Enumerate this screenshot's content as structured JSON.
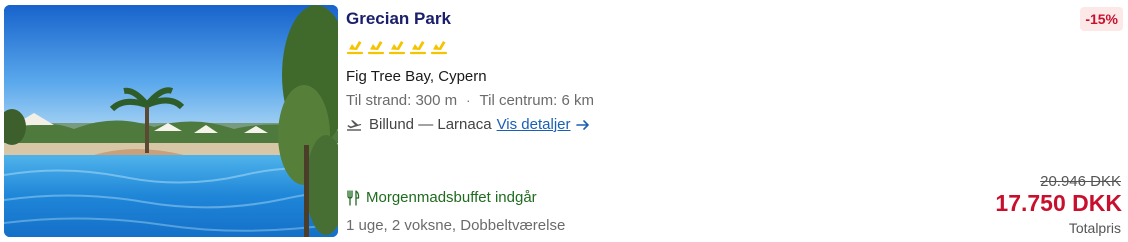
{
  "hotel": {
    "name": "Grecian Park",
    "star_count": 5,
    "star_color": "#f5c400",
    "location": "Fig Tree Bay, Cypern",
    "distance_beach": "Til strand: 300 m",
    "distance_center": "Til centrum: 6 km",
    "separator": "·",
    "photo_icon": "hotel-pool-photo"
  },
  "flight": {
    "route": "Billund — Larnaca",
    "details_link": "Vis detaljer",
    "icon": "plane-icon"
  },
  "board": {
    "label": "Morgenmadsbuffet indgår",
    "icon": "cutlery-icon",
    "color": "#1f6b1f"
  },
  "travel_info": "1 uge, 2 voksne, Dobbeltværelse",
  "pricing": {
    "discount": "-15%",
    "old_price": "20.946 DKK",
    "price": "17.750 DKK",
    "price_note": "Totalpris",
    "accent": "#c8102e"
  }
}
